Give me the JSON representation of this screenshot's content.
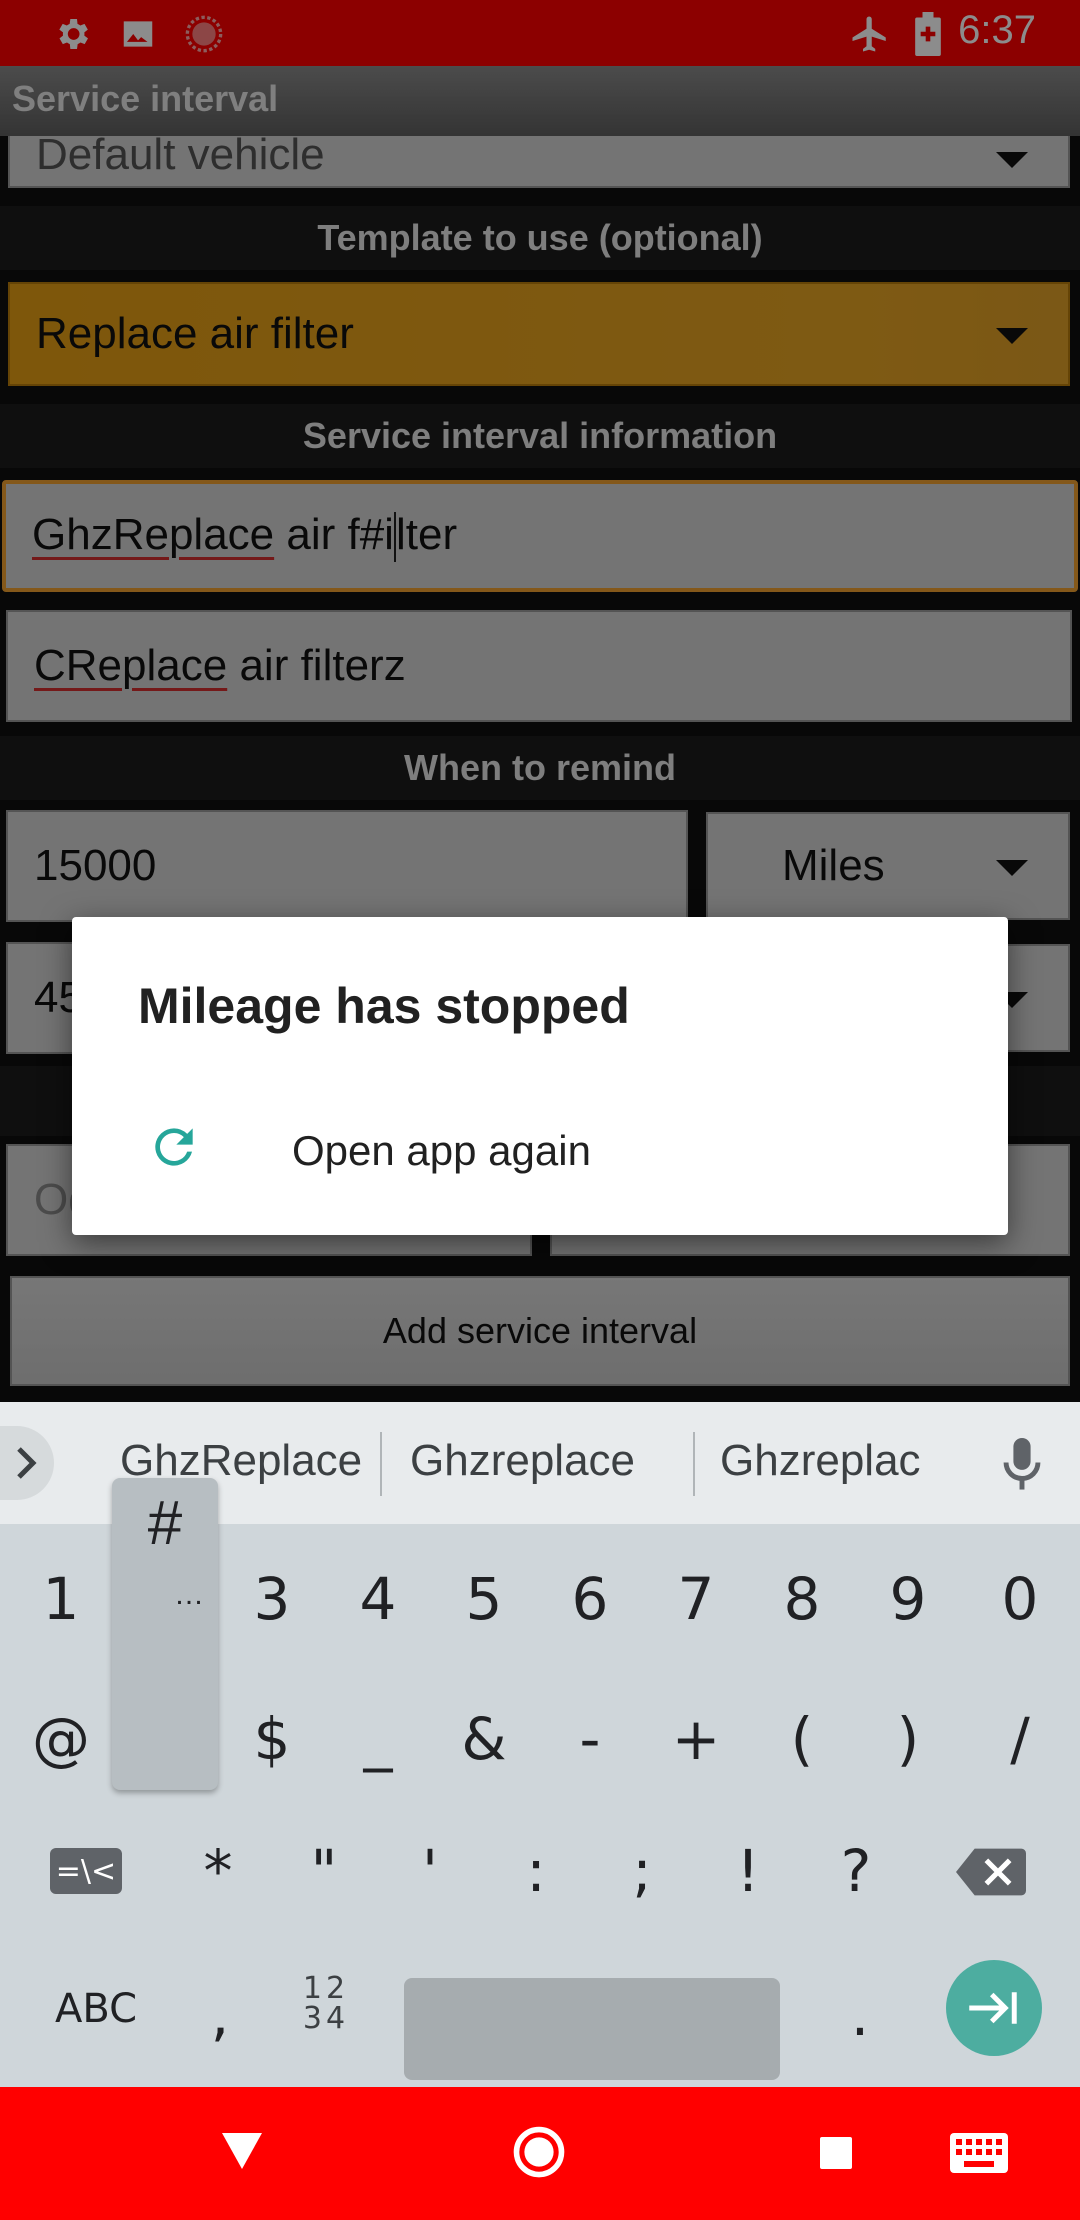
{
  "status_bar": {
    "time": "6:37",
    "icons": [
      "gear-icon",
      "image-icon",
      "record-icon",
      "airplane-icon",
      "battery-icon"
    ]
  },
  "app": {
    "title": "Service interval"
  },
  "form": {
    "vehicle_value": "Default vehicle",
    "template_header": "Template to use (optional)",
    "template_value": "Replace air filter",
    "info_header": "Service interval information",
    "name_field": {
      "prefix": "GhzReplace",
      "rest_before_cursor": " air f#i",
      "rest_after_cursor": "lter"
    },
    "desc_field": {
      "prefix": "CReplace",
      "rest": " air filterz"
    },
    "remind_header": "When to remind",
    "distance_value": "15000",
    "distance_unit": "Miles",
    "time_value_partial": "45",
    "odometer_placeholder_partial": "Od",
    "add_button": "Add service interval"
  },
  "dialog": {
    "title": "Mileage has stopped",
    "action_label": "Open app again",
    "action_icon": "refresh-icon",
    "accent_color": "#26a69a"
  },
  "keyboard": {
    "suggestions": [
      "GhzReplace",
      "Ghzreplace",
      "Ghzreplac"
    ],
    "row1": [
      "1",
      "",
      "3",
      "4",
      "5",
      "6",
      "7",
      "8",
      "9",
      "0"
    ],
    "row2": [
      "@",
      "",
      "$",
      "_",
      "&",
      "-",
      "+",
      "(",
      ")",
      "/"
    ],
    "row3": [
      "=\\<",
      "*",
      "\"",
      "'",
      ":",
      ";",
      "!",
      "?"
    ],
    "row4": {
      "abc": "ABC",
      "comma": ",",
      "numpad_top": "12",
      "numpad_bottom": "34",
      "period": "."
    },
    "popup_key": "#",
    "popup_more": "…"
  },
  "colors": {
    "status_bar": "#ff0000",
    "template_spinner": "#e59e14",
    "focus_border": "#f0a030",
    "nav_bar": "#ff0000"
  }
}
